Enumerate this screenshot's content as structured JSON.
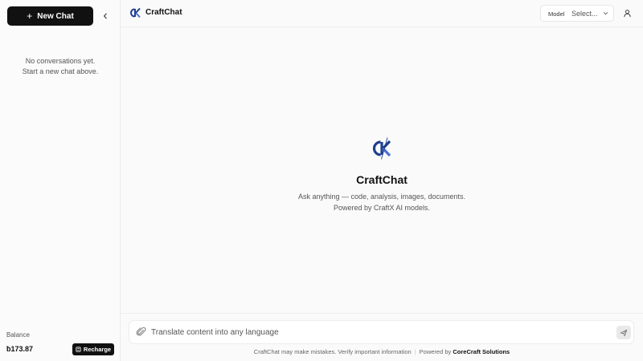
{
  "sidebar": {
    "new_chat_label": "New Chat",
    "empty_line1": "No conversations yet.",
    "empty_line2": "Start a new chat above.",
    "balance_label": "Balance",
    "balance_value": "ƀ173.87",
    "recharge_label": "Recharge"
  },
  "header": {
    "title": "CraftChat",
    "model_label": "Model",
    "model_value": "Select..."
  },
  "main": {
    "title": "CraftChat",
    "subtitle_line1": "Ask anything — code, analysis, images, documents.",
    "subtitle_line2": "Powered by CraftX AI models."
  },
  "composer": {
    "placeholder": "Translate content into any language"
  },
  "footer": {
    "disclaimer": "CraftChat may make mistakes. Verify important information",
    "powered_prefix": "Powered by",
    "powered_name": "CoreCraft Solutions"
  },
  "colors": {
    "primary": "#111111",
    "logo_blue": "#1f3f8f",
    "logo_accent": "#4b6fd6"
  },
  "icons": {
    "new_chat": "plus-icon",
    "collapse": "chevron-left-icon",
    "model_dropdown": "chevron-down-icon",
    "user": "user-icon",
    "attach": "paperclip-icon",
    "send": "send-icon",
    "recharge": "card-icon"
  }
}
